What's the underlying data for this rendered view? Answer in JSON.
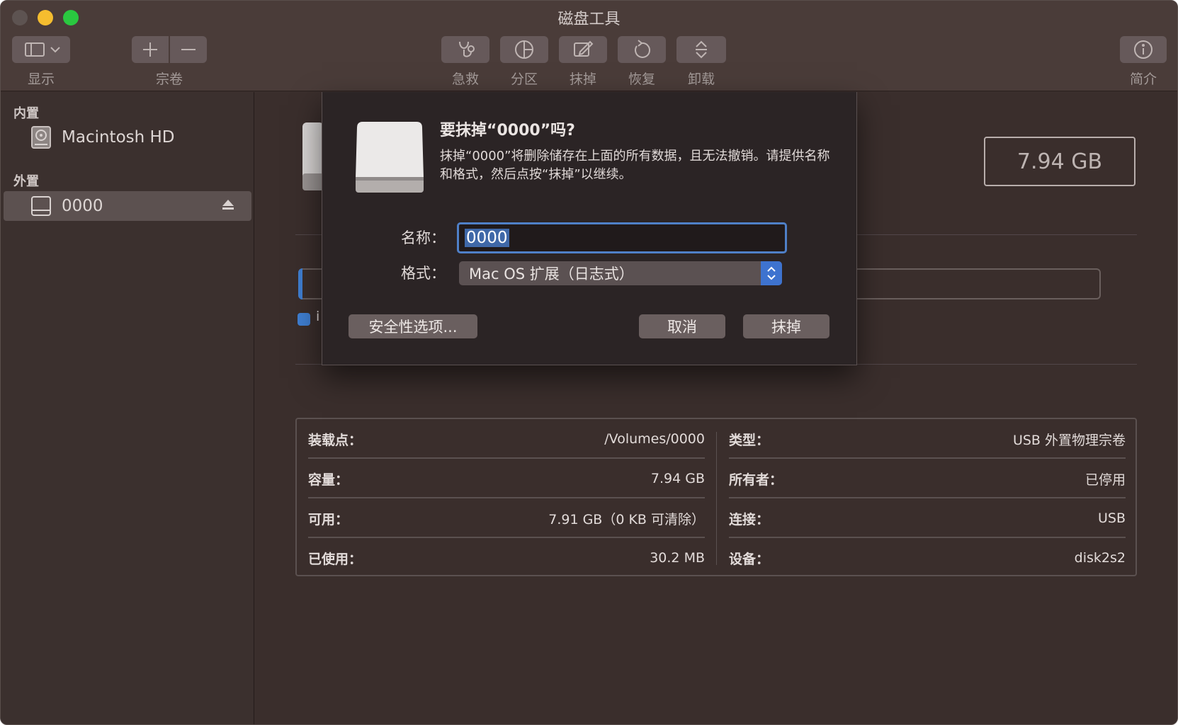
{
  "window": {
    "title": "磁盘工具"
  },
  "toolbar": {
    "view_label": "显示",
    "volume_label": "宗卷",
    "firstaid_label": "急救",
    "partition_label": "分区",
    "erase_label": "抹掉",
    "restore_label": "恢复",
    "unmount_label": "卸载",
    "info_label": "简介"
  },
  "sidebar": {
    "internal_header": "内置",
    "external_header": "外置",
    "internal_items": [
      {
        "label": "Macintosh HD"
      }
    ],
    "external_items": [
      {
        "label": "0000"
      }
    ]
  },
  "main": {
    "capacity": "7.94 GB",
    "behind_checkbox_char": "i",
    "info": {
      "left": [
        {
          "key": "装载点：",
          "value": "/Volumes/0000"
        },
        {
          "key": "容量：",
          "value": "7.94 GB"
        },
        {
          "key": "可用：",
          "value": "7.91 GB（0 KB 可清除）"
        },
        {
          "key": "已使用：",
          "value": "30.2 MB"
        }
      ],
      "right": [
        {
          "key": "类型：",
          "value": "USB 外置物理宗卷"
        },
        {
          "key": "所有者：",
          "value": "已停用"
        },
        {
          "key": "连接：",
          "value": "USB"
        },
        {
          "key": "设备：",
          "value": "disk2s2"
        }
      ]
    }
  },
  "dialog": {
    "title": "要抹掉“0000”吗?",
    "message": "抹掉“0000”将删除储存在上面的所有数据，且无法撤销。请提供名称和格式，然后点按“抹掉”以继续。",
    "name_label": "名称：",
    "name_value": "0000",
    "format_label": "格式：",
    "format_value": "Mac OS 扩展（日志式）",
    "security_button": "安全性选项...",
    "cancel_button": "取消",
    "erase_button": "抹掉"
  },
  "colors": {
    "window_bg": "#3a2e2c",
    "toolbar_bg": "#4a3c39",
    "accent_blue": "#3f7ed1",
    "traffic_yellow": "#f5bd2f",
    "traffic_green": "#2ac840"
  }
}
